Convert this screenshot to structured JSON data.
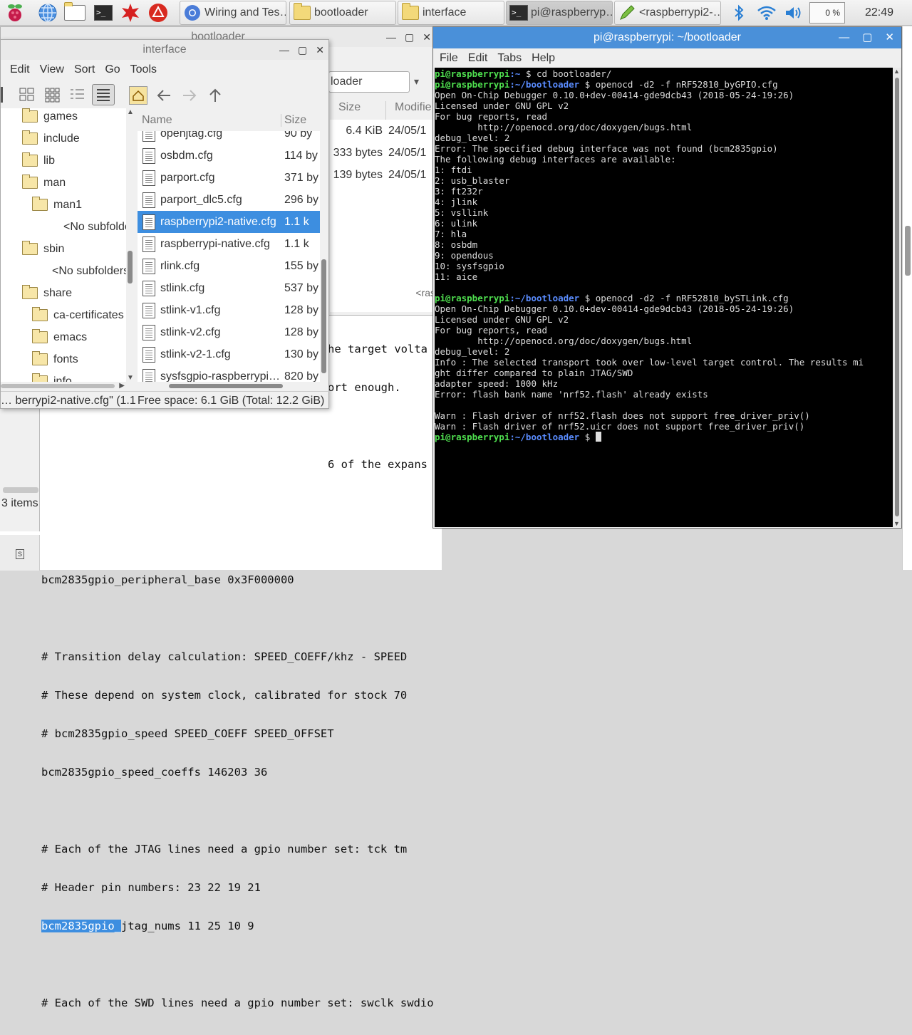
{
  "taskbar": {
    "windows": [
      {
        "label": "Wiring and Tes…"
      },
      {
        "label": "bootloader"
      },
      {
        "label": "interface"
      },
      {
        "label": "pi@raspberryp…"
      },
      {
        "label": "<raspberrypi2-…"
      }
    ],
    "cpu": "0 %",
    "clock": "22:49",
    "icons": [
      "raspberry-menu-icon",
      "globe-icon",
      "file-manager-icon",
      "terminal-icon",
      "mathematica-icon",
      "wolfram-icon"
    ]
  },
  "editor": {
    "lines": [
      "he target volta",
      "ort enough.",
      "",
      "6 of the expans",
      "",
      "",
      "bcm2835gpio_peripheral_base 0x3F000000",
      "",
      "# Transition delay calculation: SPEED_COEFF/khz - SPEED",
      "# These depend on system clock, calibrated for stock 70",
      "# bcm2835gpio_speed SPEED_COEFF SPEED_OFFSET",
      "bcm2835gpio_speed_coeffs 146203 36",
      "",
      "# Each of the JTAG lines need a gpio number set: tck tm",
      "# Header pin numbers: 23 22 19 21",
      "jtag_nums 11 25 10 9",
      "",
      "# Each of the SWD lines need a gpio number set: swclk swdio"
    ],
    "highlight": "bcm2835gpio_"
  },
  "bootloader": {
    "title": "bootloader",
    "path": "loader",
    "columns": [
      "Size",
      "Modifie"
    ],
    "rows": [
      {
        "size": "6.4 KiB",
        "mod": "24/05/1"
      },
      {
        "size": "333 bytes",
        "mod": "24/05/1"
      },
      {
        "size": "139 bytes",
        "mod": "24/05/1"
      }
    ],
    "status_right": "<ras",
    "items": "3 items"
  },
  "interface": {
    "title": "interface",
    "menu": [
      "Edit",
      "View",
      "Sort",
      "Go",
      "Tools"
    ],
    "tree": [
      {
        "label": "games",
        "indent": 0
      },
      {
        "label": "include",
        "indent": 0
      },
      {
        "label": "lib",
        "indent": 0
      },
      {
        "label": "man",
        "indent": 0
      },
      {
        "label": "man1",
        "indent": 1
      },
      {
        "label": "<No subfolde",
        "indent": 2
      },
      {
        "label": "sbin",
        "indent": 0
      },
      {
        "label": "<No subfolders",
        "indent": 3
      },
      {
        "label": "share",
        "indent": 0
      },
      {
        "label": "ca-certificates",
        "indent": 1
      },
      {
        "label": "emacs",
        "indent": 1
      },
      {
        "label": "fonts",
        "indent": 1
      },
      {
        "label": "info",
        "indent": 1
      }
    ],
    "columns": {
      "name": "Name",
      "size": "Size"
    },
    "files": [
      {
        "name": "openjtag.cfg",
        "size": "90 by"
      },
      {
        "name": "osbdm.cfg",
        "size": "114 by"
      },
      {
        "name": "parport.cfg",
        "size": "371 by"
      },
      {
        "name": "parport_dlc5.cfg",
        "size": "296 by"
      },
      {
        "name": "raspberrypi2-native.cfg",
        "size": "1.1 k",
        "selected": true
      },
      {
        "name": "raspberrypi-native.cfg",
        "size": "1.1 k"
      },
      {
        "name": "rlink.cfg",
        "size": "155 by"
      },
      {
        "name": "stlink.cfg",
        "size": "537 by"
      },
      {
        "name": "stlink-v1.cfg",
        "size": "128 by"
      },
      {
        "name": "stlink-v2.cfg",
        "size": "128 by"
      },
      {
        "name": "stlink-v2-1.cfg",
        "size": "130 by"
      },
      {
        "name": "sysfsgpio-raspberrypi…",
        "size": "820 by"
      }
    ],
    "status_left": "berrypi2-native.cfg\" (1.1 …",
    "status_right": "Free space: 6.1 GiB (Total: 12.2 GiB)"
  },
  "terminal": {
    "title": "pi@raspberrypi: ~/bootloader",
    "menu": [
      "File",
      "Edit",
      "Tabs",
      "Help"
    ],
    "lines": [
      {
        "user": "pi@raspberrypi",
        "path": ":~",
        "cmd": " $ cd bootloader/"
      },
      {
        "user": "pi@raspberrypi",
        "path": ":~/bootloader",
        "cmd": " $ openocd -d2 -f nRF52810_byGPIO.cfg"
      },
      {
        "text": "Open On-Chip Debugger 0.10.0+dev-00414-gde9dcb43 (2018-05-24-19:26)"
      },
      {
        "text": "Licensed under GNU GPL v2"
      },
      {
        "text": "For bug reports, read"
      },
      {
        "text": "        http://openocd.org/doc/doxygen/bugs.html"
      },
      {
        "text": "debug_level: 2"
      },
      {
        "text": "Error: The specified debug interface was not found (bcm2835gpio)"
      },
      {
        "text": "The following debug interfaces are available:"
      },
      {
        "text": "1: ftdi"
      },
      {
        "text": "2: usb_blaster"
      },
      {
        "text": "3: ft232r"
      },
      {
        "text": "4: jlink"
      },
      {
        "text": "5: vsllink"
      },
      {
        "text": "6: ulink"
      },
      {
        "text": "7: hla"
      },
      {
        "text": "8: osbdm"
      },
      {
        "text": "9: opendous"
      },
      {
        "text": "10: sysfsgpio"
      },
      {
        "text": "11: aice"
      },
      {
        "text": ""
      },
      {
        "user": "pi@raspberrypi",
        "path": ":~/bootloader",
        "cmd": " $ openocd -d2 -f nRF52810_bySTLink.cfg"
      },
      {
        "text": "Open On-Chip Debugger 0.10.0+dev-00414-gde9dcb43 (2018-05-24-19:26)"
      },
      {
        "text": "Licensed under GNU GPL v2"
      },
      {
        "text": "For bug reports, read"
      },
      {
        "text": "        http://openocd.org/doc/doxygen/bugs.html"
      },
      {
        "text": "debug_level: 2"
      },
      {
        "text": "Info : The selected transport took over low-level target control. The results mi"
      },
      {
        "text": "ght differ compared to plain JTAG/SWD"
      },
      {
        "text": "adapter speed: 1000 kHz"
      },
      {
        "text": "Error: flash bank name 'nrf52.flash' already exists"
      },
      {
        "text": ""
      },
      {
        "text": "Warn : Flash driver of nrf52.flash does not support free_driver_priv()"
      },
      {
        "text": "Warn : Flash driver of nrf52.uicr does not support free_driver_priv()"
      },
      {
        "user": "pi@raspberrypi",
        "path": ":~/bootloader",
        "cmd": " $ ",
        "cursor": true
      }
    ]
  },
  "colors": {
    "accent": "#4a90d9",
    "prompt_user": "#4fe04f",
    "prompt_path": "#5a8cff",
    "selection": "#3d8ee0"
  }
}
